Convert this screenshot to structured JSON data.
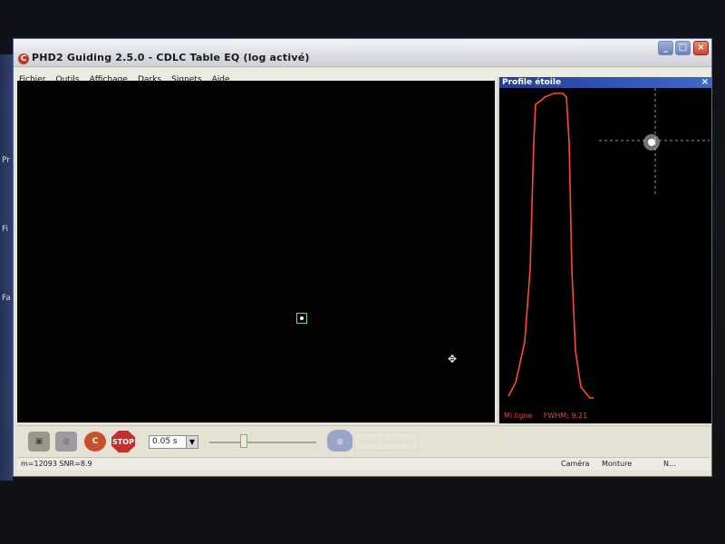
{
  "desktop": {
    "left_labels": [
      "Pr",
      "Fi",
      "Fa"
    ]
  },
  "window": {
    "title": "PHD2 Guiding 2.5.0 - CDLC Table EQ (log activé)",
    "icon": "phd2-app-icon",
    "controls": {
      "minimize": "_",
      "maximize": "□",
      "close": "×"
    }
  },
  "menu": {
    "items": [
      "Fichier",
      "Outils",
      "Affichage",
      "Darks",
      "Signets",
      "Aide"
    ]
  },
  "guide_view": {
    "star_box_color": "#7fd08a",
    "background": "#020203"
  },
  "profile": {
    "title": "Profile étoile",
    "close": "×",
    "mode_label": "Mi ligne",
    "fwhm_label": "FWHM: 9.21",
    "curve_color": "#ff4a33",
    "crosshair_color": "#3bd34a"
  },
  "toolbar": {
    "camera_icon": "camera-icon",
    "mount_icon": "mount-icon",
    "calib_icon": "calibration-icon",
    "stop_label": "STOP",
    "exposure_value": "0.05 s",
    "gain_level": 0.3,
    "start_label": "Start Guiding"
  },
  "status": {
    "left": "m=12093 SNR=8.9",
    "camera": "Caméra",
    "mount": "Monture",
    "extra": "N..."
  }
}
